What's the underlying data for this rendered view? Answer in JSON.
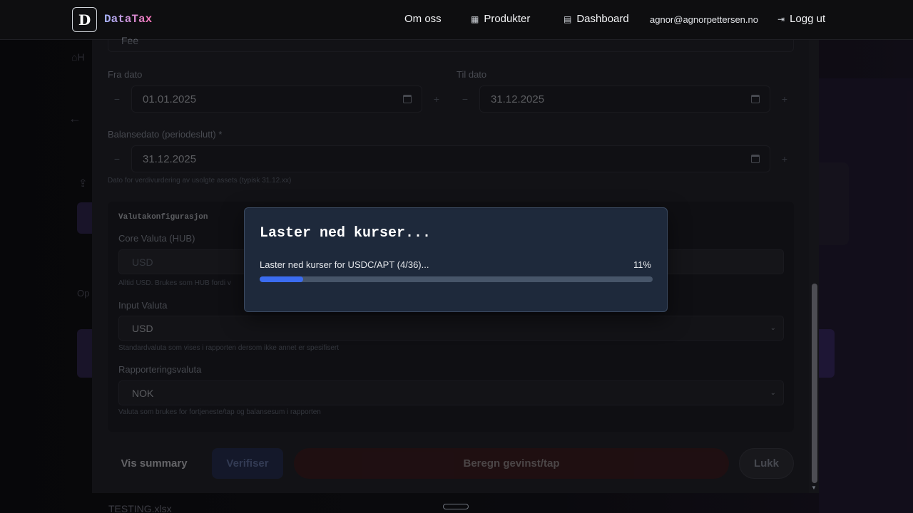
{
  "nav": {
    "brand_letter": "D",
    "brand_name": "DataTax",
    "links": [
      {
        "label": "Om oss",
        "icon": ""
      },
      {
        "label": "Produkter",
        "icon": "calculator-icon"
      },
      {
        "label": "Dashboard",
        "icon": "document-icon"
      }
    ],
    "email": "agnor@agnorpettersen.no",
    "logout_label": "Logg ut",
    "logout_icon": "logout-icon"
  },
  "background": {
    "home_label": "H",
    "operations_label": "Op",
    "file_label": "TESTING.xlsx"
  },
  "form": {
    "top_field_value": "Fee",
    "from_date_label": "Fra dato",
    "from_date_value": "01.01.2025",
    "to_date_label": "Til dato",
    "to_date_value": "31.12.2025",
    "balance_date_label": "Balansedato (periodeslutt) *",
    "balance_date_value": "31.12.2025",
    "balance_date_hint": "Dato for verdivurdering av usolgte assets (typisk 31.12.xx)",
    "minus": "−",
    "plus": "+"
  },
  "currency_config": {
    "title": "Valutakonfigurasjon",
    "core_label": "Core Valuta (HUB)",
    "core_value": "USD",
    "core_hint": "Alltid USD. Brukes som HUB fordi v",
    "input_label": "Input Valuta",
    "input_value": "USD",
    "input_hint": "Standardvaluta som vises i rapporten dersom ikke annet er spesifisert",
    "reporting_label": "Rapporteringsvaluta",
    "reporting_value": "NOK",
    "reporting_hint": "Valuta som brukes for fortjeneste/tap og balansesum i rapporten"
  },
  "actions": {
    "summary_label": "Vis summary",
    "verify_label": "Verifiser",
    "calculate_label": "Beregn gevinst/tap",
    "close_label": "Lukk"
  },
  "progress_dialog": {
    "title": "Laster ned kurser...",
    "status": "Laster ned kurser for USDC/APT (4/36)...",
    "percent_label": "11%",
    "progress": 0.11,
    "accent_color": "#3b6cf0"
  }
}
